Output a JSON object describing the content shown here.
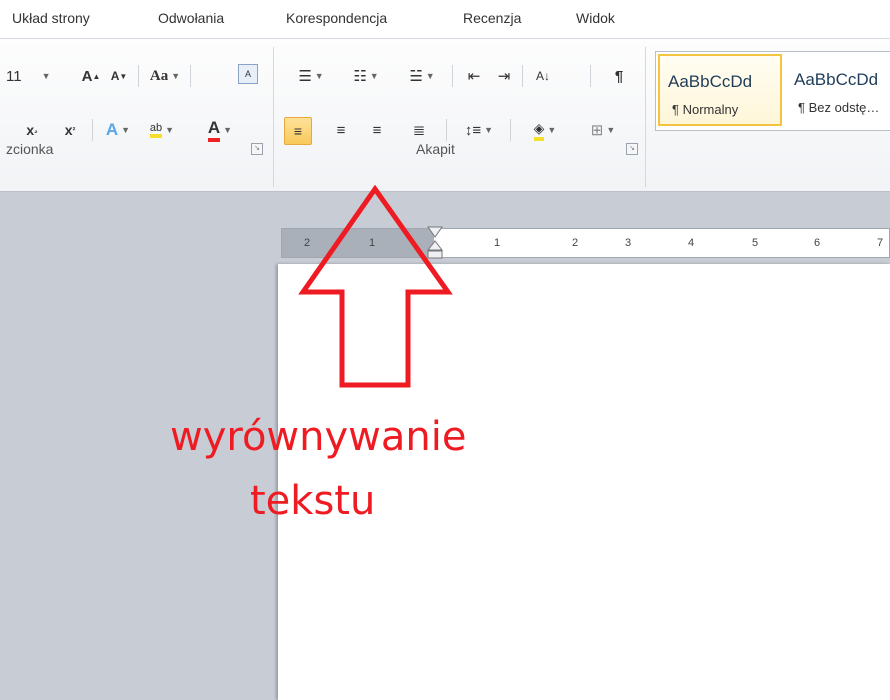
{
  "tabs": [
    "Układ strony",
    "Odwołania",
    "Korespondencja",
    "Recenzja",
    "Widok"
  ],
  "ribbon": {
    "font_group_label": "zcionka",
    "paragraph_group_label": "Akapit",
    "font_size": "11",
    "font_buttons": {
      "grow": "A",
      "shrink": "A",
      "change_case": "Aa",
      "subscript": "x",
      "superscript": "x",
      "font_color": "A"
    },
    "styles": [
      {
        "sample": "AaBbCcDd",
        "name": "¶ Normalny",
        "selected": true
      },
      {
        "sample": "AaBbCcDd",
        "name": "¶ Bez odstę…",
        "selected": false
      }
    ]
  },
  "ruler": {
    "ticks": [
      "2",
      "1",
      "1",
      "2",
      "3",
      "4",
      "5",
      "6",
      "7"
    ]
  },
  "annotation": {
    "line1": "wyrównywanie",
    "line2": "tekstu",
    "color": "#ef1b23"
  },
  "colors": {
    "ribbon_bg": "#f1f3f6",
    "workspace_bg": "#c8cdd5",
    "active_button": "#f9c95b",
    "annotation_red": "#ef1b23"
  }
}
